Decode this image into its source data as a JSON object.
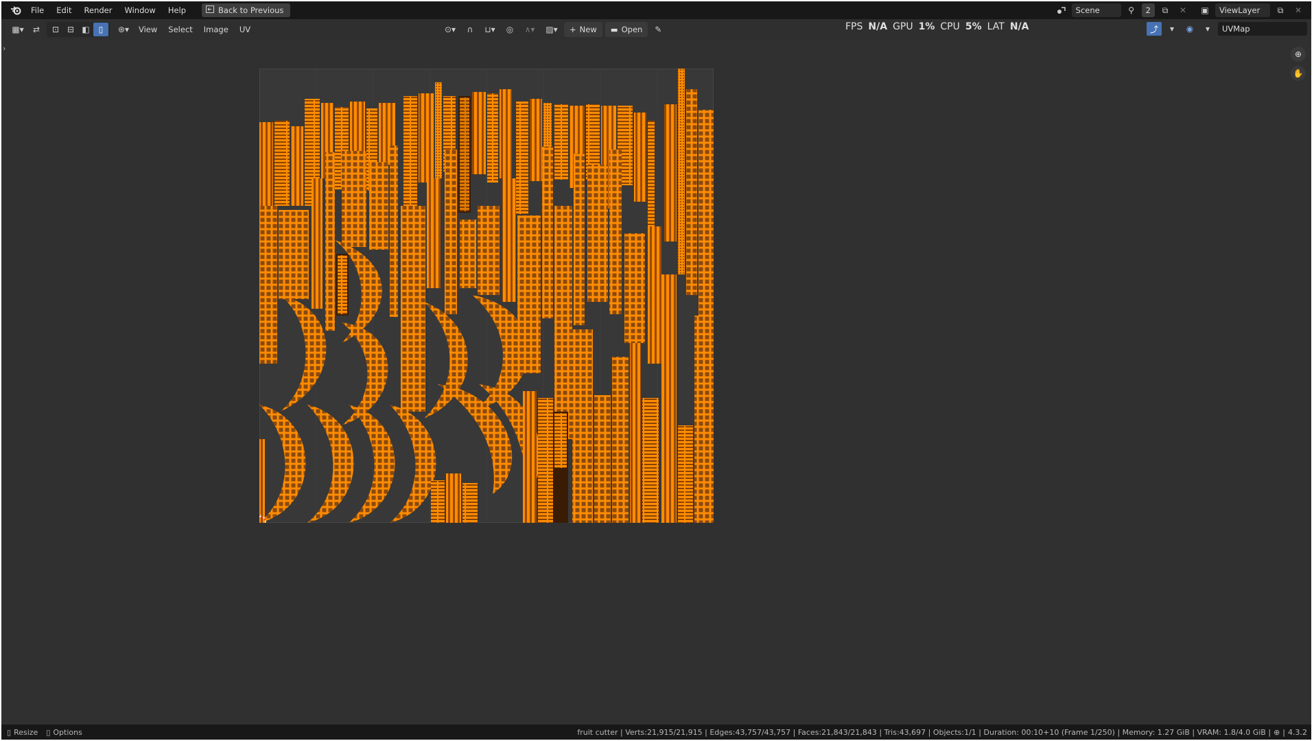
{
  "topbar": {
    "menus": [
      "File",
      "Edit",
      "Render",
      "Window",
      "Help"
    ],
    "back_button": "Back to Previous",
    "scene": "Scene",
    "scene_users": "2",
    "view_layer": "ViewLayer"
  },
  "header": {
    "menus": [
      "View",
      "Select",
      "Image",
      "UV"
    ],
    "new_button": "New",
    "open_button": "Open",
    "uv_map": "UVMap"
  },
  "perf": {
    "fps_label": "FPS",
    "fps_value": "N/A",
    "gpu_label": "GPU",
    "gpu_value": "1%",
    "cpu_label": "CPU",
    "cpu_value": "5%",
    "lat_label": "LAT",
    "lat_value": "N/A"
  },
  "statusbar": {
    "resize": "Resize",
    "options": "Options",
    "info": "fruit cutter | Verts:21,915/21,915 | Edges:43,757/43,757 | Faces:21,843/21,843 | Tris:43,697 | Objects:1/1 | Duration: 00:10+10 (Frame 1/250) | Memory: 1.27 GiB | VRAM: 1.8/4.0 GiB |",
    "version": "4.3.2"
  },
  "colors": {
    "uv_orange": "#ff8c00",
    "uv_dark": "#5a2e08",
    "accent_blue": "#4772b3"
  },
  "icons": [
    "blender-logo-icon",
    "back-icon",
    "editor-type-icon",
    "sync-selection-icon",
    "select-mode-icons",
    "pivot-icon",
    "snap-icon",
    "proportional-icon",
    "image-browse-icon",
    "new-icon",
    "folder-icon",
    "pin-icon",
    "uv-sculpt-icon",
    "overlay-icon",
    "zoom-icon",
    "hand-pan-icon",
    "cursor-icon"
  ]
}
